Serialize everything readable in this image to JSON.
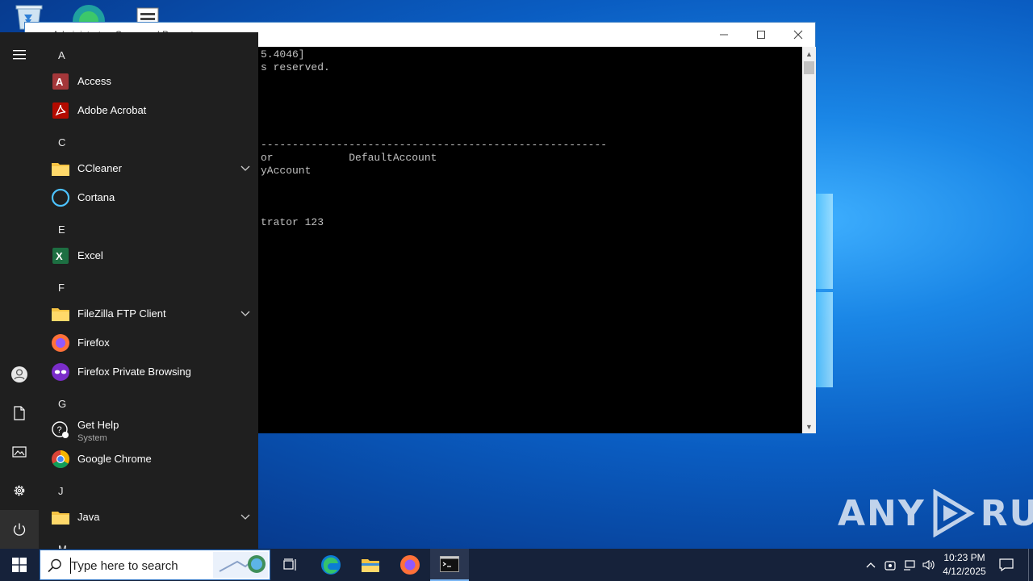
{
  "cmd_window": {
    "title": "Administrator: Command Prompt",
    "lines": [
      "5.4046]",
      "s reserved.",
      "-------------------------------------------------------",
      "or            DefaultAccount",
      "yAccount",
      "trator 123"
    ]
  },
  "start_menu": {
    "letters": [
      "A",
      "C",
      "E",
      "F",
      "G",
      "J",
      "M"
    ],
    "apps": [
      {
        "label": "Access"
      },
      {
        "label": "Adobe Acrobat"
      },
      {
        "label": "CCleaner"
      },
      {
        "label": "Cortana"
      },
      {
        "label": "Excel"
      },
      {
        "label": "FileZilla FTP Client"
      },
      {
        "label": "Firefox"
      },
      {
        "label": "Firefox Private Browsing"
      },
      {
        "label": "Get Help",
        "sub": "System"
      },
      {
        "label": "Google Chrome"
      },
      {
        "label": "Java"
      }
    ]
  },
  "taskbar": {
    "search_placeholder": "Type here to search",
    "time": "10:23 PM",
    "date": "4/12/2025"
  },
  "watermark": {
    "left": "ANY",
    "right": "RUN"
  },
  "colors": {
    "accent": "#0078d7",
    "taskbar": "#16223a",
    "start_bg": "#1f1f1f"
  }
}
